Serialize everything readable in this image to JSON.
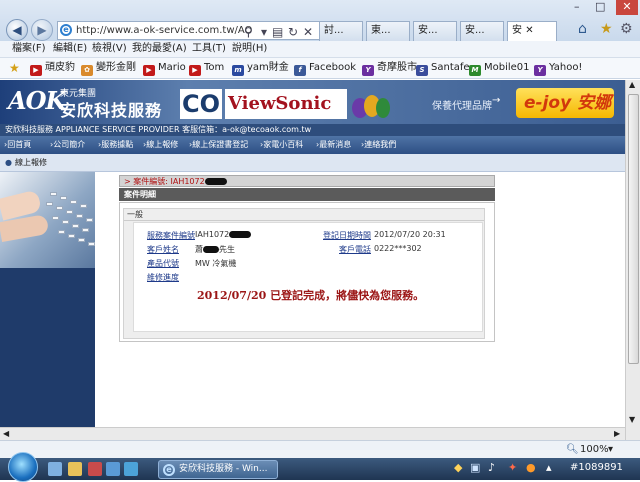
{
  "browser": {
    "url": "http://www.a-ok-service.com.tw/AO",
    "tabs": [
      "討...",
      "東...",
      "安...",
      "安...",
      "安"
    ],
    "menu": [
      "檔案(F)",
      "編輯(E)",
      "檢視(V)",
      "我的最愛(A)",
      "工具(T)",
      "說明(H)"
    ],
    "favorites": [
      "頑皮豹",
      "變形金剛",
      "Mario",
      "Tom",
      "yam財金",
      "Facebook",
      "奇摩股市",
      "Santafe",
      "Mobile01",
      "Yahoo!"
    ],
    "zoom": "100%"
  },
  "taskbar": {
    "task_label": "安欣科技服務 - Win...",
    "watermark": "#1089891"
  },
  "site": {
    "logo": "AOK",
    "group": "東元集團",
    "company": "安欣科技服務",
    "service_bar": "安欣科技服務 APPLIANCE SERVICE PROVIDER 客服信箱：a-ok@tecoaok.com.tw",
    "ad_co": "CO",
    "ad_viewsonic": "ViewSonic",
    "ad_promo": "保養代理品牌",
    "ad_arrow": "→",
    "ad_ejoy": "e-joy 安娜",
    "nav": [
      "回首頁",
      "公司簡介",
      "服務據點",
      "線上報修",
      "線上保證書登記",
      "家電小百科",
      "最新消息",
      "連絡我們"
    ],
    "subnav": "線上報修"
  },
  "case": {
    "crumb": "> 案件編號: IAH1072",
    "panel_title": "案件明細",
    "section": "一般",
    "labels": [
      "服務案件編號",
      "客戶姓名",
      "產品代號",
      "維修進度",
      "登記日期時間",
      "客戶電話"
    ],
    "case_no": "IAH1072",
    "customer": "蕭",
    "customer_suffix": "先生",
    "product": "MW 冷氣機",
    "reg_time": "2012/07/20 20:31",
    "phone": "0222***302",
    "done_msg": "2012/07/20 已登記完成，將儘快為您服務。"
  }
}
